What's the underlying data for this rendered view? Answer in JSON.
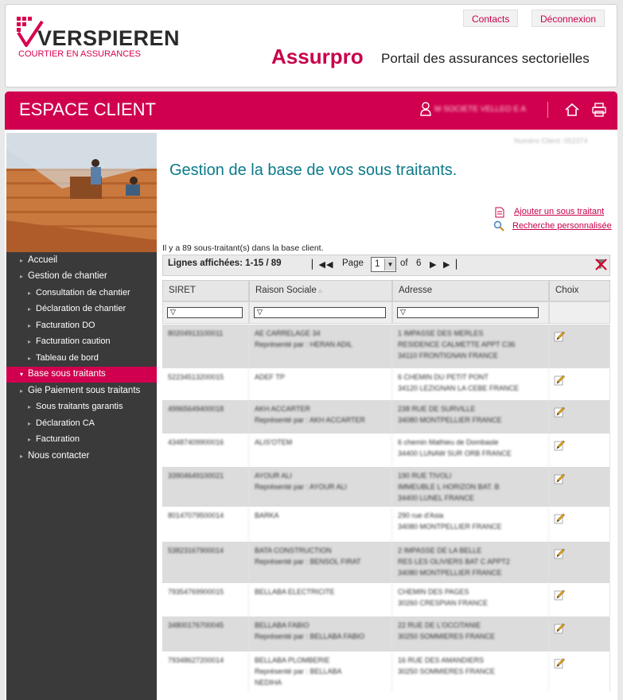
{
  "header": {
    "logo_name": "VERSPIEREN",
    "logo_tagline": "COURTIER EN ASSURANCES",
    "contacts_label": "Contacts",
    "logout_label": "Déconnexion",
    "site_name": "Assurpro",
    "site_subtitle": "Portail des assurances sectorielles"
  },
  "band": {
    "title": "ESPACE CLIENT",
    "user_name": "M SOCIETE VELLEO E A"
  },
  "client_number": "Numéro Client: 052374",
  "page_title": "Gestion de la base de vos sous traitants.",
  "actions": {
    "add_label": "Ajouter un sous traitant",
    "search_label": "Recherche personnalisée"
  },
  "count_text": "Il y a 89 sous-traitant(s) dans la base client.",
  "pager": {
    "lines_label": "Lignes affichées: 1-15 / 89",
    "page_label": "Page",
    "current_page": "1",
    "of_label": "of",
    "total_pages": "6"
  },
  "sidebar": {
    "items": [
      {
        "label": "Accueil"
      },
      {
        "label": "Gestion de chantier"
      },
      {
        "label": "Consultation de chantier"
      },
      {
        "label": "Déclaration de chantier"
      },
      {
        "label": "Facturation DO"
      },
      {
        "label": "Facturation caution"
      },
      {
        "label": "Tableau de bord"
      },
      {
        "label": "Base sous traitants"
      },
      {
        "label": "Gie Paiement sous traitants"
      },
      {
        "label": "Sous traitants garantis"
      },
      {
        "label": "Déclaration CA"
      },
      {
        "label": "Facturation"
      },
      {
        "label": "Nous contacter"
      }
    ]
  },
  "table": {
    "columns": [
      "SIRET",
      "Raison Sociale",
      "Adresse",
      "Choix"
    ],
    "rows": [
      {
        "siret": "80204913100011",
        "raison": [
          "AE CARRELAGE 34",
          "Représenté par : HERAN ADIL"
        ],
        "adresse": [
          "1 IMPASSE DES MERLES",
          "RESIDENCE CALMETTE APPT C36",
          "34110 FRONTIGNAN FRANCE"
        ]
      },
      {
        "siret": "52234513200015",
        "raison": [
          "ADEF TP"
        ],
        "adresse": [
          "6 CHEMIN DU PETIT PONT",
          "34120 LEZIGNAN LA CEBE FRANCE"
        ]
      },
      {
        "siret": "49965649400018",
        "raison": [
          "AKH ACCARTER",
          "Représenté par : AKH ACCARTER"
        ],
        "adresse": [
          "238 RUE DE SURVILLE",
          "34080 MONTPELLIER FRANCE"
        ]
      },
      {
        "siret": "43487409900016",
        "raison": [
          "ALIS'OTEM"
        ],
        "adresse": [
          "6 chemin Mathieu de Dombasle",
          "34400 LUNAW SUR ORB FRANCE"
        ]
      },
      {
        "siret": "33904649100021",
        "raison": [
          "AYOUR ALI",
          "Représenté par : AYOUR ALI"
        ],
        "adresse": [
          "190 RUE TIVOLI",
          "IMMEUBLE L HORIZON BAT. B",
          "34400 LUNEL FRANCE"
        ]
      },
      {
        "siret": "80147079500014",
        "raison": [
          "BARKA"
        ],
        "adresse": [
          "290 rue d'Asia",
          "34080 MONTPELLIER FRANCE"
        ]
      },
      {
        "siret": "53823167900014",
        "raison": [
          "BATA CONSTRUCTION",
          "Représenté par : BENSOL FIRAT"
        ],
        "adresse": [
          "2 IMPASSE DE LA BELLE",
          "RES LES OLIVIERS BAT C APPT2",
          "34080 MONTPELLIER FRANCE"
        ]
      },
      {
        "siret": "79354769900015",
        "raison": [
          "BELLABA ELECTRICITE"
        ],
        "adresse": [
          "CHEMIN DES PAGES",
          "30260 CRESPIAN FRANCE"
        ]
      },
      {
        "siret": "34800176700045",
        "raison": [
          "BELLABA FABIO",
          "Représenté par : BELLABA FABIO"
        ],
        "adresse": [
          "22 RUE DE L'OCCITANIE",
          "30250 SOMMIERES FRANCE"
        ]
      },
      {
        "siret": "79348627200014",
        "raison": [
          "BELLABA PLOMBERIE",
          "Représenté par : BELLABA",
          "NEDIHA"
        ],
        "adresse": [
          "16 RUE DES AMANDIERS",
          "30250 SOMMIERES FRANCE"
        ]
      }
    ]
  },
  "colors": {
    "brand": "#d0004f",
    "title_teal": "#0c7a8a",
    "sidebar_bg": "#3a3a3a"
  }
}
